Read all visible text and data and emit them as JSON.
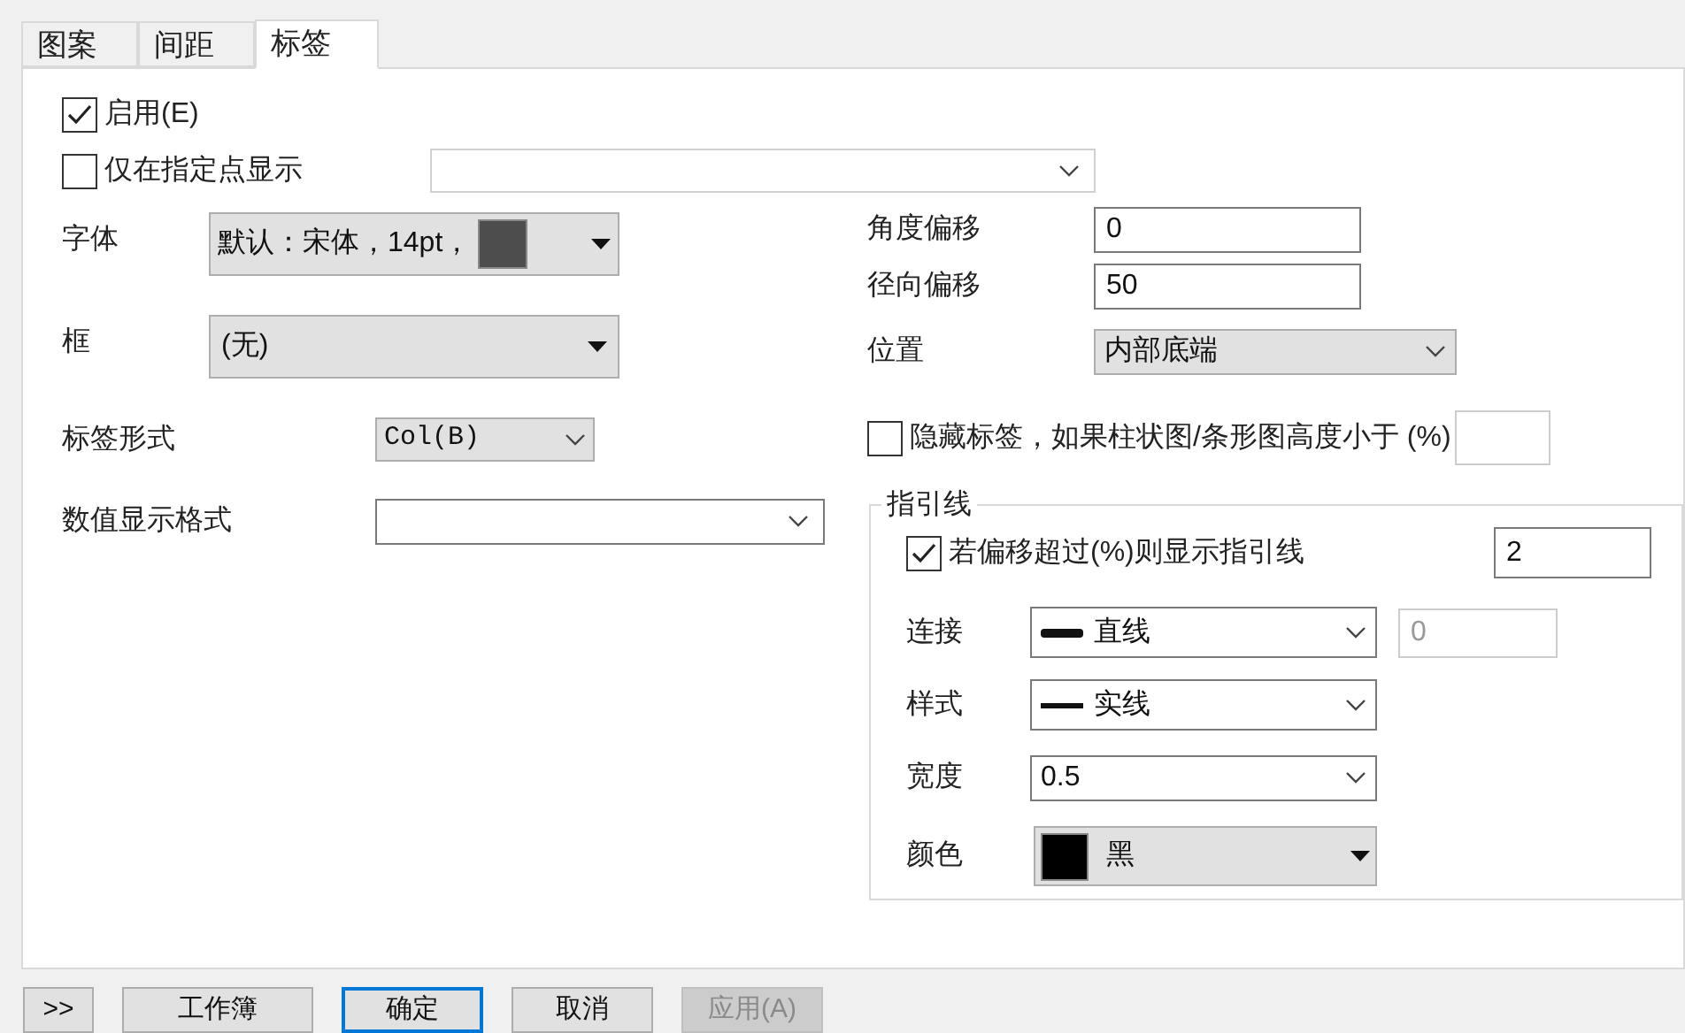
{
  "tabs": [
    {
      "label": "图案",
      "selected": false
    },
    {
      "label": "间距",
      "selected": false
    },
    {
      "label": "标签",
      "selected": true
    }
  ],
  "enable": {
    "label": "启用(E)",
    "checked": true
  },
  "specified_points": {
    "label": "仅在指定点显示",
    "checked": false
  },
  "font": {
    "label": "字体",
    "value": "默认：宋体，14pt，"
  },
  "frame": {
    "label": "框",
    "value": "(无)"
  },
  "label_form": {
    "label": "标签形式",
    "value": "Col(B)"
  },
  "number_format": {
    "label": "数值显示格式"
  },
  "angle_offset": {
    "label": "角度偏移",
    "value": "0"
  },
  "radial_offset": {
    "label": "径向偏移",
    "value": "50"
  },
  "position": {
    "label": "位置",
    "value": "内部底端"
  },
  "hide_labels": {
    "label": "隐藏标签，如果柱状图/条形图高度小于 (%)",
    "checked": false
  },
  "leader_lines": {
    "title": "指引线",
    "show": {
      "label": "若偏移超过(%)则显示指引线",
      "checked": true,
      "value": "2"
    },
    "connection": {
      "label": "连接",
      "value": "直线",
      "extra_value": "0",
      "extra_disabled": true
    },
    "style": {
      "label": "样式",
      "value": "实线"
    },
    "width": {
      "label": "宽度",
      "value": "0.5"
    },
    "color": {
      "label": "颜色",
      "value": "黑"
    }
  },
  "buttons": [
    {
      "label": ">>",
      "kind": "normal"
    },
    {
      "label": "工作簿",
      "kind": "normal"
    },
    {
      "label": "确定",
      "kind": "default"
    },
    {
      "label": "取消",
      "kind": "normal"
    },
    {
      "label": "应用(A)",
      "kind": "disabled"
    }
  ]
}
